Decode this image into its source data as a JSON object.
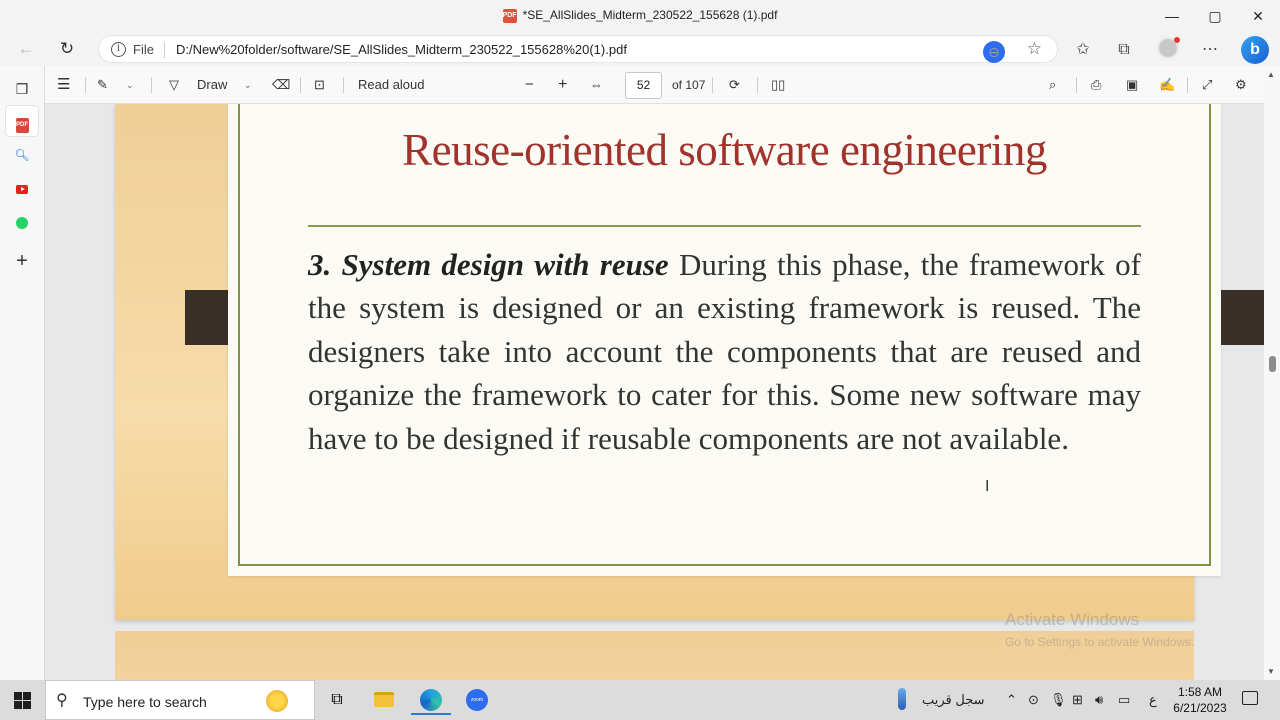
{
  "window": {
    "title": "*SE_AllSlides_Midterm_230522_155628 (1).pdf",
    "pdf_badge": "PDF",
    "minimize": "—",
    "maximize": "▢",
    "close": "✕"
  },
  "address_bar": {
    "back_icon": "arrow-left",
    "refresh_icon": "refresh",
    "scheme_label": "File",
    "url": "D:/New%20folder/software/SE_AllSlides_Midterm_230522_155628%20(1).pdf"
  },
  "sidebar": {
    "items": [
      "tabs",
      "pdf",
      "search",
      "youtube",
      "whatsapp",
      "add"
    ],
    "pdf_badge": "PDF"
  },
  "pdf_toolbar": {
    "draw_label": "Draw",
    "read_aloud_label": "Read aloud",
    "zoom_out": "−",
    "zoom_in": "+",
    "current_page": "52",
    "total_pages": "of 107"
  },
  "slide": {
    "title": "Reuse-oriented software engineering",
    "heading": "3. System design with reuse",
    "body": " During this phase, the framework of the system is designed or an existing framework is reused. The designers take into account the components that are reused and organize the framework to cater for this. Some new software may have to be designed if reusable components are not available."
  },
  "watermark": {
    "line1": "Activate Windows",
    "line2": "Go to Settings to activate Windows."
  },
  "taskbar": {
    "search_placeholder": "Type here to search",
    "zoom_label": "zoom",
    "tray_text": "سجل قريب",
    "lang": "ع",
    "time": "1:58 AM",
    "date": "6/21/2023"
  },
  "colors": {
    "title_red": "#a0332b",
    "border_green": "#7f9245",
    "slide_bg": "#f6dcaa"
  }
}
